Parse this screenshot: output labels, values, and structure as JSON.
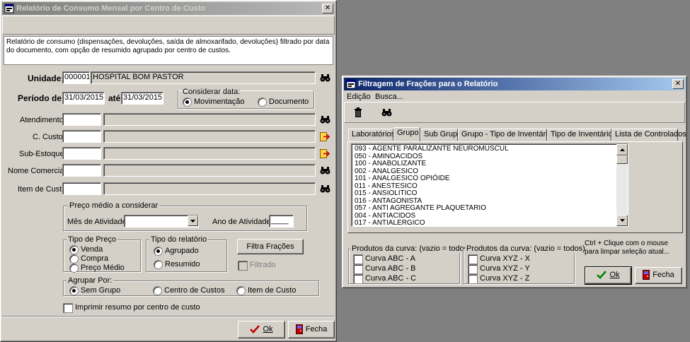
{
  "main_window": {
    "title": "Relatório de Consumo Mensal por Centro de Custo",
    "close_glyph": "✕",
    "description": "Relatório de consumo (dispensações, devoluções, saída de almoxarifado, devoluções) filtrado por data do documento, com opção de resumido agrupado por centro de custos.",
    "unidade_label": "Unidade:",
    "unidade_code": "000001",
    "unidade_name": "HOSPITAL BOM PASTOR",
    "periodo_label": "Período de:",
    "periodo_from": "31/03/2015",
    "periodo_ate": "até",
    "periodo_to": "31/03/2015",
    "considerar_title": "Considerar data:",
    "considerar_movimentacao": "Movimentação",
    "considerar_documento": "Documento",
    "atendimento_label": "Atendimento:",
    "ccusto_label": "C. Custo:",
    "subestoque_label": "Sub-Estoque:",
    "nomecomercial_label": "Nome Comercial:",
    "itemcusto_label": "Item de Custo:",
    "preco_medio_title": "Preço médio a considerar",
    "mes_label": "Mês de Atividade:",
    "ano_label": "Ano de Atividade:",
    "ano_value": "____",
    "tipo_preco_title": "Tipo de Preço",
    "tipo_preco_venda": "Venda",
    "tipo_preco_compra": "Compra",
    "tipo_preco_medio": "Preço Médio",
    "tipo_rel_title": "Tipo do relatório",
    "tipo_rel_agrupado": "Agrupado",
    "tipo_rel_resumido": "Resumido",
    "filtra_fracoes_label": "Filtra Frações",
    "filtrado_label": "Filtrado",
    "agrupar_title": "Agrupar Por:",
    "agrupar_sem": "Sem Grupo",
    "agrupar_centro": "Centro de Custos",
    "agrupar_item": "Item de Custo",
    "imprimir_label": "Imprimir resumo por centro de custo",
    "ok_label": "Ok",
    "fecha_label": "Fecha"
  },
  "filter_window": {
    "title": "Filtragem de Frações para o Relatório",
    "close_glyph": "✕",
    "menu_edicao": "Edição",
    "menu_busca": "Busca...",
    "tabs": [
      "Laboratórios",
      "Grupo",
      "Sub Grupo",
      "Grupo - Tipo de Inventário",
      "Tipo de Inventário",
      "Lista de Controlados"
    ],
    "list_items": [
      "093 - AGENTE PARALIZANTE NEUROMUSCUL",
      "050 - AMINOACIDOS",
      "100 - ANABOLIZANTE",
      "002 - ANALGESICO",
      "101 - ANALGESICO OPIÓIDE",
      "011 - ANESTESICO",
      "015 - ANSIOLITICO",
      "016 - ANTAGONISTA",
      "057 - ANTI AGREGANTE PLAQUETARIO",
      "004 - ANTIACIDOS",
      "017 - ANTIALERGICO"
    ],
    "abc_title": "Produtos da curva:  (vazio = todos)",
    "abc_items": [
      "Curva ABC - A",
      "Curva ABC - B",
      "Curva ABC - C"
    ],
    "xyz_title": "Produtos da curva:  (vazio = todos)",
    "xyz_items": [
      "Curva XYZ - X",
      "Curva XYZ - Y",
      "Curva XYZ - Z"
    ],
    "hint": "Ctrl + Clique com o mouse para limpar seleção atual...",
    "ok_label": "Ok",
    "fecha_label": "Fecha"
  }
}
